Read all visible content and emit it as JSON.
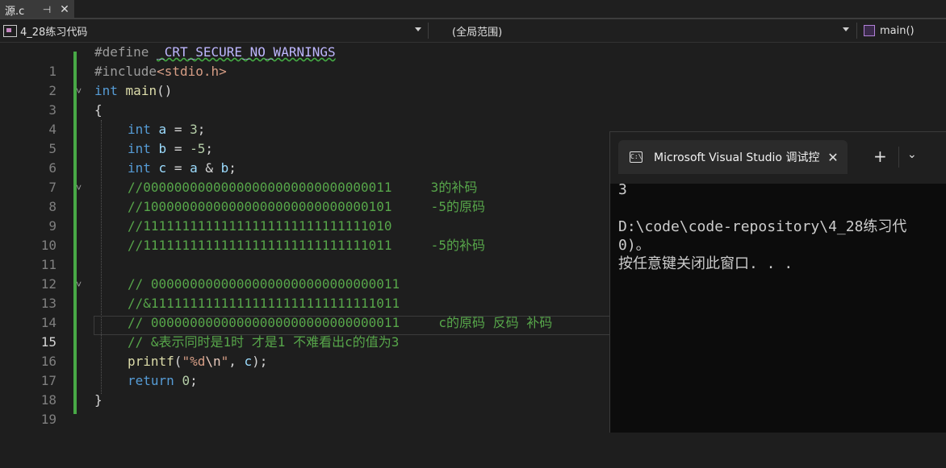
{
  "tab": {
    "filename": "源.c",
    "pin_glyph": "⊣",
    "close_glyph": "✕"
  },
  "navbar": {
    "project": "4_28练习代码",
    "scope": "(全局范围)",
    "member": "main()"
  },
  "editor": {
    "current_line": 15,
    "line_numbers": [
      "1",
      "2",
      "3",
      "4",
      "5",
      "6",
      "7",
      "8",
      "9",
      "10",
      "11",
      "12",
      "13",
      "14",
      "15",
      "16",
      "17",
      "18",
      "19"
    ],
    "lines": {
      "l1": {
        "pp": "#define ",
        "macro": "_CRT_SECURE_NO_WARNINGS"
      },
      "l2": {
        "pp": "#include",
        "file": "<stdio.h>"
      },
      "l3": {
        "kw": "int",
        "fn": "main",
        "rest": "()"
      },
      "l4": {
        "text": "{"
      },
      "l5": {
        "kw": "int",
        "var": "a",
        "op": " = ",
        "num": "3",
        "end": ";"
      },
      "l6": {
        "kw": "int",
        "var": "b",
        "op": " = ",
        "num": "-5",
        "end": ";"
      },
      "l7": {
        "kw": "int",
        "var": "c",
        "op": " = ",
        "a": "a",
        "amp": " & ",
        "b": "b",
        "end": ";"
      },
      "l8": {
        "comment": "//00000000000000000000000000000011     3的补码"
      },
      "l9": {
        "comment": "//10000000000000000000000000000101     -5的原码"
      },
      "l10": {
        "comment": "//11111111111111111111111111111010"
      },
      "l11": {
        "comment": "//11111111111111111111111111111011     -5的补码"
      },
      "l13": {
        "comment": "// 00000000000000000000000000000011"
      },
      "l14": {
        "comment": "//&11111111111111111111111111111011"
      },
      "l15": {
        "comment": "// 00000000000000000000000000000011     c的原码 反码 补码"
      },
      "l16": {
        "comment": "// &表示同时是1时 才是1 不难看出c的值为3"
      },
      "l17": {
        "fn": "printf",
        "open": "(",
        "str1": "\"%d",
        "esc": "\\n",
        "str2": "\"",
        "comma": ", ",
        "var": "c",
        "close": ");"
      },
      "l18": {
        "kw": "return",
        "num": "0",
        "end": ";"
      },
      "l19": {
        "text": "}"
      }
    }
  },
  "console": {
    "title": "Microsoft Visual Studio 调试控",
    "icon_text": "C:\\",
    "close_glyph": "✕",
    "plus_glyph": "+",
    "chevron_glyph": "⌄",
    "output": "3\n\nD:\\code\\code-repository\\4_28练习代\n0)。\n按任意键关闭此窗口. . ."
  },
  "icons": {
    "project": "project-icon",
    "member": "method-cube-icon",
    "console": "console-app-icon"
  },
  "colors": {
    "editor_bg": "#1e1e1e",
    "keyword": "#569cd6",
    "comment": "#57a64a",
    "change_bar": "#48a846",
    "console_bg": "#0c0c0c"
  }
}
